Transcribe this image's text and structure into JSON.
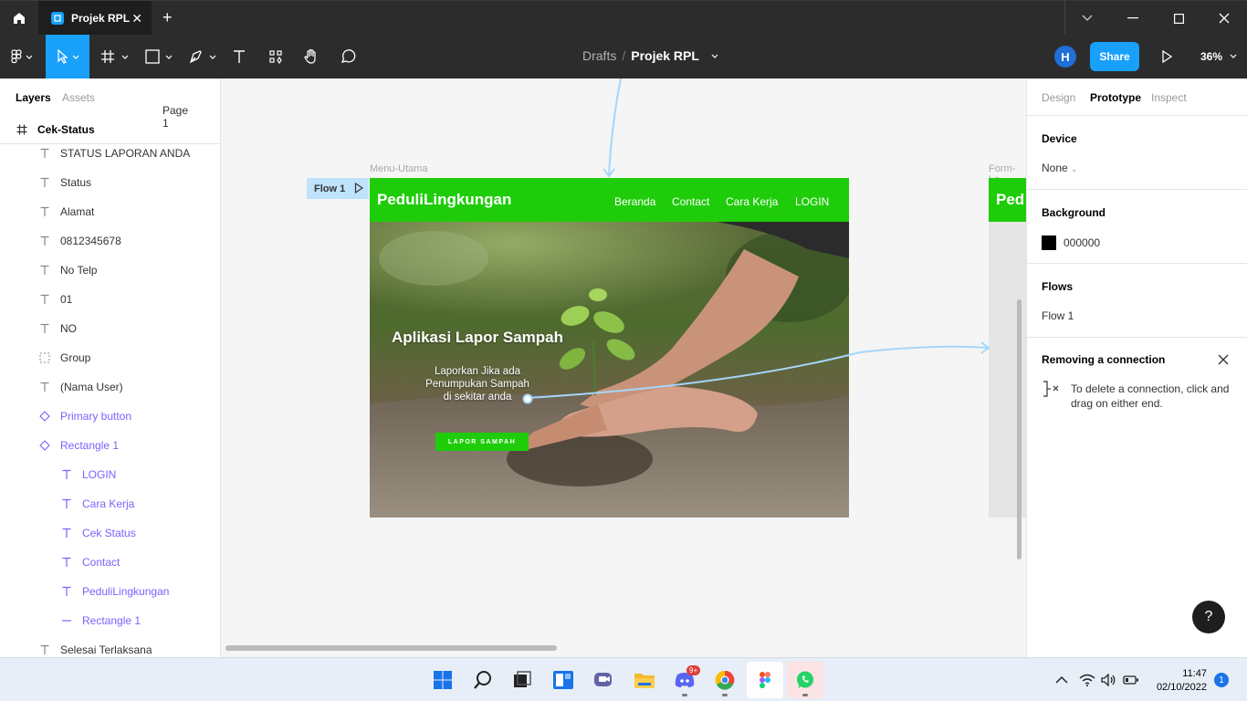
{
  "titlebar": {
    "tab_label": "Projek RPL"
  },
  "toolbar": {
    "breadcrumb_parent": "Drafts",
    "breadcrumb_separator": "/",
    "project_name": "Projek RPL",
    "avatar_initial": "H",
    "share_label": "Share",
    "zoom": "36%"
  },
  "layers_panel": {
    "tabs": [
      "Layers",
      "Assets"
    ],
    "page": "Page 1",
    "frame": "Cek-Status",
    "items": [
      {
        "label": "STATUS LAPORAN ANDA",
        "type": "text"
      },
      {
        "label": "Status",
        "type": "text"
      },
      {
        "label": "Alamat",
        "type": "text"
      },
      {
        "label": "0812345678",
        "type": "text"
      },
      {
        "label": "No Telp",
        "type": "text"
      },
      {
        "label": "01",
        "type": "text"
      },
      {
        "label": "NO",
        "type": "text"
      },
      {
        "label": "Group",
        "type": "group"
      },
      {
        "label": "(Nama User)",
        "type": "text"
      },
      {
        "label": "Primary button",
        "type": "component"
      },
      {
        "label": "Rectangle 1",
        "type": "component"
      },
      {
        "label": "LOGIN",
        "type": "text"
      },
      {
        "label": "Cara Kerja",
        "type": "text"
      },
      {
        "label": "Cek Status",
        "type": "text"
      },
      {
        "label": "Contact",
        "type": "text"
      },
      {
        "label": "PeduliLingkungan",
        "type": "text"
      },
      {
        "label": "Rectangle 1",
        "type": "line"
      },
      {
        "label": "Selesai Terlaksana",
        "type": "text"
      }
    ]
  },
  "canvas": {
    "flow_tag": "Flow 1",
    "frame1_label": "Menu-Utama",
    "frame2_label": "Form-La",
    "menu_utama": {
      "brand": "PeduliLingkungan",
      "nav": [
        "Beranda",
        "Contact",
        "Cara Kerja",
        "LOGIN"
      ],
      "hero_title": "Aplikasi Lapor Sampah",
      "hero_sub_1": "Laporkan Jika ada",
      "hero_sub_2": "Penumpukan Sampah",
      "hero_sub_3": "di sekitar anda",
      "cta": "LAPOR SAMPAH"
    },
    "form_brand": "Ped"
  },
  "inspector": {
    "tabs": [
      "Design",
      "Prototype",
      "Inspect"
    ],
    "active_tab": "Prototype",
    "device_heading": "Device",
    "device_value": "None",
    "background_heading": "Background",
    "background_value": "000000",
    "flows_heading": "Flows",
    "flow_item": "Flow 1",
    "removing_heading": "Removing a connection",
    "removing_text": "To delete a connection, click and drag on either end.",
    "help": "?"
  },
  "taskbar": {
    "time": "11:47",
    "date": "02/10/2022",
    "notifications": "1",
    "discord_badge": "9+"
  },
  "colors": {
    "accent": "#18a0fb",
    "brand_green": "#1fcc0a",
    "component_purple": "#7b61ff"
  }
}
